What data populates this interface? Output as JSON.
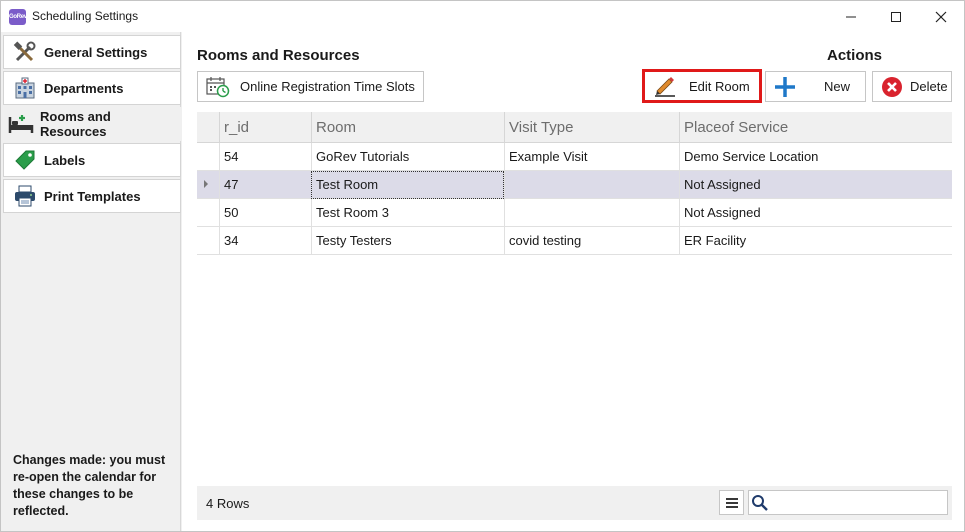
{
  "window": {
    "title": "Scheduling Settings",
    "app_icon_text": "GoRev"
  },
  "sidebar": {
    "items": [
      {
        "label": "General Settings",
        "icon": "tools-icon"
      },
      {
        "label": "Departments",
        "icon": "building-icon"
      },
      {
        "label": "Rooms and Resources",
        "icon": "bed-icon",
        "active": true
      },
      {
        "label": "Labels",
        "icon": "tag-icon"
      },
      {
        "label": "Print Templates",
        "icon": "printer-icon"
      }
    ],
    "note": "Changes made: you must re-open the calendar for these changes to be reflected."
  },
  "main": {
    "section_title": "Rooms and Resources",
    "actions_title": "Actions",
    "buttons": {
      "slots": "Online Registration Time Slots",
      "edit": "Edit Room",
      "new": "New",
      "delete": "Delete"
    },
    "columns": [
      "r_id",
      "Room",
      "Visit Type",
      "Placeof Service"
    ],
    "rows": [
      [
        "54",
        "GoRev Tutorials",
        "Example Visit",
        "Demo Service Location"
      ],
      [
        "47",
        "Test Room",
        "",
        "Not Assigned"
      ],
      [
        "50",
        "Test Room 3",
        "",
        "Not Assigned"
      ],
      [
        "34",
        "Testy Testers",
        "covid testing",
        "ER Facility"
      ]
    ],
    "footer": {
      "row_count": "4 Rows",
      "search_value": ""
    }
  },
  "colors": {
    "highlight": "#e01919",
    "selected_row": "#dcdbe8",
    "new_icon": "#1f78c8",
    "delete_icon": "#d9232e"
  }
}
